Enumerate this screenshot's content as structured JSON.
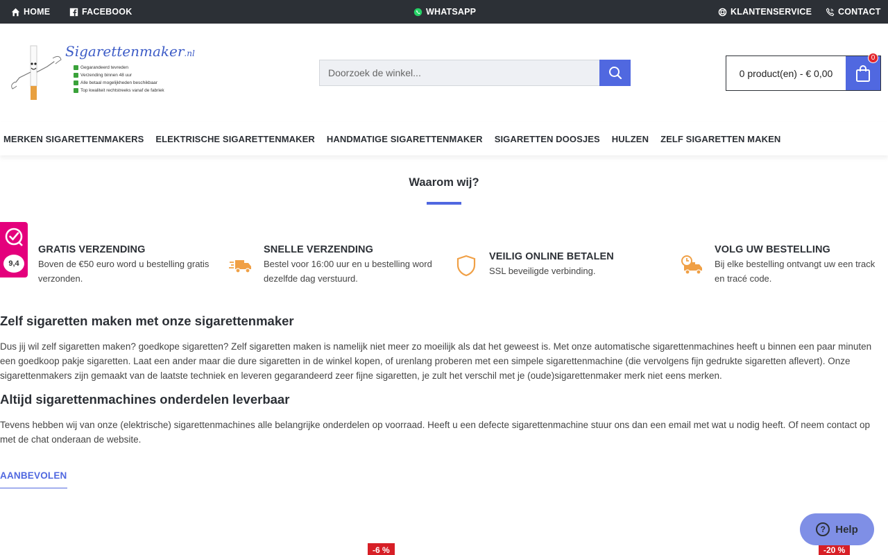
{
  "topbar": {
    "home": "HOME",
    "facebook": "FACEBOOK",
    "whatsapp": "WHATSAPP",
    "klantenservice": "KLANTENSERVICE",
    "contact": "CONTACT"
  },
  "logo": {
    "wordmark": "Sigarettenmaker",
    "tld": ".nl",
    "bullets": [
      "Gegarandeerd tevreden",
      "Verzending binnen 48 uur",
      "Alle betaal mogelijkheden beschikbaar",
      "Top kwaliteit rechtstreeks vanaf de fabriek"
    ]
  },
  "search": {
    "placeholder": "Doorzoek de winkel..."
  },
  "cart": {
    "summary": "0 product(en) - € 0,00",
    "count": "0"
  },
  "nav": [
    "MERKEN SIGARETTENMAKERS",
    "ELEKTRISCHE SIGARETTENMAKER",
    "HANDMATIGE SIGARETTENMAKER",
    "SIGARETTEN DOOSJES",
    "HULZEN",
    "ZELF SIGARETTEN MAKEN"
  ],
  "why": {
    "title": "Waarom wij?"
  },
  "rating": {
    "score": "9,4"
  },
  "features": [
    {
      "title": "GRATIS VERZENDING",
      "text": "Boven de €50 euro word u bestelling gratis verzonden."
    },
    {
      "title": "SNELLE VERZENDING",
      "text": "Bestel voor 16:00 uur en u bestelling word dezelfde dag verstuurd."
    },
    {
      "title": "VEILIG ONLINE BETALEN",
      "text": "SSL beveiligde verbinding."
    },
    {
      "title": "VOLG UW BESTELLING",
      "text": "Bij elke bestelling ontvangt uw een track en tracé code."
    }
  ],
  "content": {
    "h1": "Zelf sigaretten maken met onze sigarettenmaker",
    "p1": "Dus jij wil zelf sigaretten maken? goedkope sigaretten? Zelf sigaretten maken is namelijk niet meer zo moeilijk als dat het geweest is. Met onze automatische sigarettenmachines heeft u binnen een paar minuten een goedkoop pakje sigaretten. Laat een ander maar die dure sigaretten in de winkel kopen, of urenlang proberen met een simpele sigarettenmachine (die vervolgens fijn gedrukte sigaretten aflevert). Onze sigarettenmakers zijn gemaakt van de laatste techniek en leveren gegarandeerd zeer fijne sigaretten, je zult het verschil met je (oude)sigarettenmaker merk niet eens merken.",
    "h2": "Altijd sigarettenmachines onderdelen leverbaar",
    "p2": "Tevens hebben wij van onze (elektrische) sigarettenmachines alle belangrijke onderdelen op voorraad. Heeft u een defecte sigarettenmachine stuur ons dan een email met wat u nodig heeft. Of neem contact op met de chat onderaan de website."
  },
  "recommended": {
    "label": "AANBEVOLEN"
  },
  "discounts": [
    "-6 %",
    "-20 %"
  ],
  "help": {
    "label": "Help"
  },
  "colors": {
    "accent": "#5068e0",
    "topbar": "#2c3036",
    "feature_icon": "#f0a046",
    "badge": "#e4007c",
    "discount": "#d71f26"
  }
}
